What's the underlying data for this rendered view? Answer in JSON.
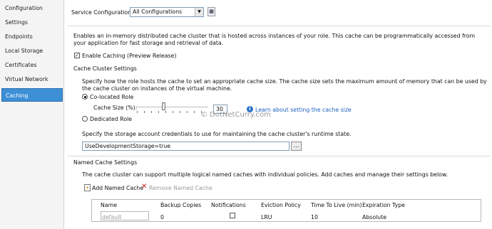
{
  "sidebar": {
    "items": [
      {
        "label": "Configuration"
      },
      {
        "label": "Settings"
      },
      {
        "label": "Endpoints"
      },
      {
        "label": "Local Storage"
      },
      {
        "label": "Certificates"
      },
      {
        "label": "Virtual Network"
      },
      {
        "label": "Caching"
      }
    ],
    "active_index": 6,
    "active_color": "#3d8fd6"
  },
  "service_config": {
    "label": "Service Configuration:",
    "value": "All Configurations"
  },
  "description": "Enables an in-memory distributed cache cluster that is hosted across instances of your role. This cache can be programmatically accessed from your application for fast storage and retrieval of data.",
  "enable_caching": {
    "label": "Enable Caching (Preview Release)",
    "checked": true
  },
  "cluster": {
    "heading": "Cache Cluster Settings",
    "description": "Specify how the role hosts the cache to set an appropriate cache size. The cache size sets the maximum amount of memory that can be used by the cache cluster on instances of the virtual machine.",
    "colocated_label": "Co-located Role",
    "cache_size_label": "Cache Size (%):",
    "cache_size_value": "30",
    "learn_link": "Learn about setting the cache size",
    "dedicated_label": "Dedicated Role"
  },
  "watermark": "© DotNetCurry.com",
  "storage": {
    "description": "Specify the storage account credentials to use for maintaining the cache cluster's runtime state.",
    "value": "UseDevelopmentStorage=true",
    "browse_label": "..."
  },
  "named": {
    "heading": "Named Cache Settings",
    "description": "The cache cluster can support multiple logical named caches with individual policies. Add caches and manage their settings below.",
    "add_label": "Add Named Cache",
    "remove_label": "Remove Named Cache",
    "columns": [
      "Name",
      "Backup Copies",
      "Notifications",
      "Eviction Policy",
      "Time To Live (min)",
      "Expiration Type"
    ],
    "rows": [
      {
        "name": "default",
        "backup": "0",
        "notifications": false,
        "eviction": "LRU",
        "ttl": "10",
        "expiration": "Absolute"
      }
    ]
  }
}
